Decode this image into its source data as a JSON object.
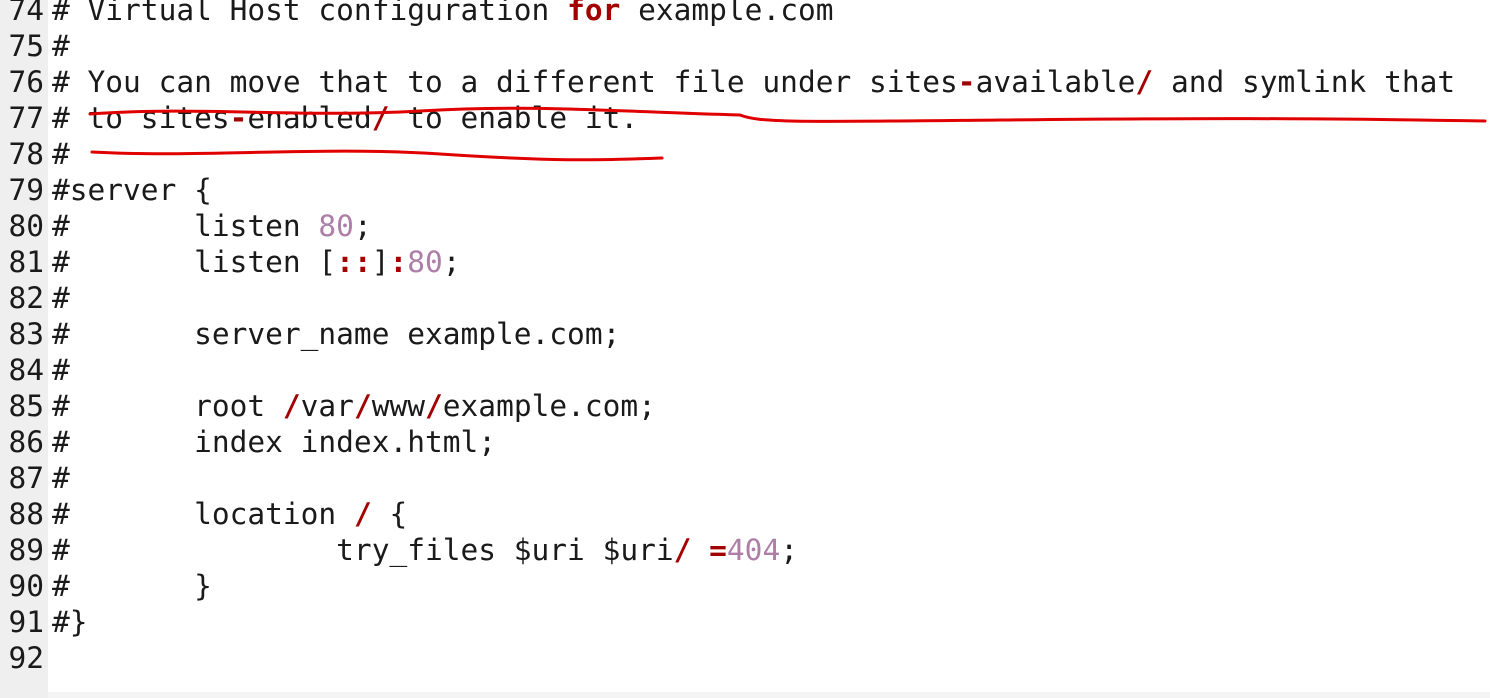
{
  "editor": {
    "lines": [
      {
        "n": "74",
        "segs": [
          {
            "t": "# Virtual Host configuration "
          },
          {
            "t": "for",
            "c": "kw"
          },
          {
            "t": " example.com"
          }
        ]
      },
      {
        "n": "75",
        "segs": [
          {
            "t": "#"
          }
        ]
      },
      {
        "n": "76",
        "segs": [
          {
            "t": "# You can move that to a different file under sites"
          },
          {
            "t": "-",
            "c": "op"
          },
          {
            "t": "available"
          },
          {
            "t": "/",
            "c": "op"
          },
          {
            "t": " and symlink that"
          }
        ]
      },
      {
        "n": "77",
        "segs": [
          {
            "t": "# to sites"
          },
          {
            "t": "-",
            "c": "op"
          },
          {
            "t": "enabled"
          },
          {
            "t": "/",
            "c": "op"
          },
          {
            "t": " to enable it."
          }
        ]
      },
      {
        "n": "78",
        "segs": [
          {
            "t": "#"
          }
        ]
      },
      {
        "n": "79",
        "segs": [
          {
            "t": "#server {"
          }
        ]
      },
      {
        "n": "80",
        "segs": [
          {
            "t": "#       listen "
          },
          {
            "t": "80",
            "c": "num"
          },
          {
            "t": ";"
          }
        ]
      },
      {
        "n": "81",
        "segs": [
          {
            "t": "#       listen ["
          },
          {
            "t": "::",
            "c": "op"
          },
          {
            "t": "]"
          },
          {
            "t": ":",
            "c": "op"
          },
          {
            "t": "80",
            "c": "num"
          },
          {
            "t": ";"
          }
        ]
      },
      {
        "n": "82",
        "segs": [
          {
            "t": "#"
          }
        ]
      },
      {
        "n": "83",
        "segs": [
          {
            "t": "#       server_name example.com;"
          }
        ]
      },
      {
        "n": "84",
        "segs": [
          {
            "t": "#"
          }
        ]
      },
      {
        "n": "85",
        "segs": [
          {
            "t": "#       root "
          },
          {
            "t": "/",
            "c": "op"
          },
          {
            "t": "var"
          },
          {
            "t": "/",
            "c": "op"
          },
          {
            "t": "www"
          },
          {
            "t": "/",
            "c": "op"
          },
          {
            "t": "example.com;"
          }
        ]
      },
      {
        "n": "86",
        "segs": [
          {
            "t": "#       index index.html;"
          }
        ]
      },
      {
        "n": "87",
        "segs": [
          {
            "t": "#"
          }
        ]
      },
      {
        "n": "88",
        "segs": [
          {
            "t": "#       location "
          },
          {
            "t": "/",
            "c": "op"
          },
          {
            "t": " {"
          }
        ]
      },
      {
        "n": "89",
        "segs": [
          {
            "t": "#               try_files $uri $uri"
          },
          {
            "t": "/",
            "c": "op"
          },
          {
            "t": " "
          },
          {
            "t": "=",
            "c": "op"
          },
          {
            "t": "404",
            "c": "num"
          },
          {
            "t": ";"
          }
        ]
      },
      {
        "n": "90",
        "segs": [
          {
            "t": "#       }"
          }
        ]
      },
      {
        "n": "91",
        "segs": [
          {
            "t": "#}"
          }
        ]
      },
      {
        "n": "92",
        "segs": [
          {
            "t": ""
          }
        ]
      }
    ]
  },
  "colors": {
    "keyword": "#a40000",
    "number": "#ad7fa8",
    "annotation": "#e00000",
    "gutter": "#efefef"
  }
}
